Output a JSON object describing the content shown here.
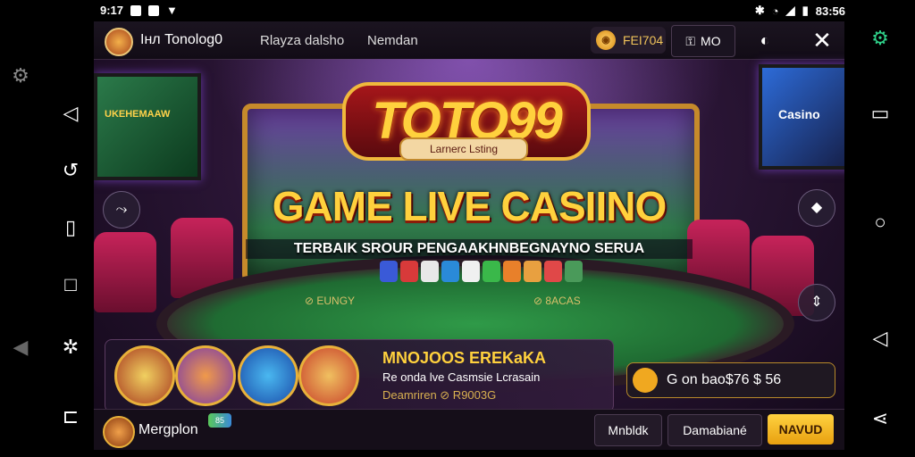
{
  "statusbar": {
    "left_text": "9:17",
    "right_text": "83:56"
  },
  "topbar": {
    "brand": "Iнл Tonolog0",
    "nav": [
      "Rlayza dalsho",
      "Nemdan"
    ],
    "coins": "FEI704",
    "mo_button": "MO"
  },
  "hero": {
    "logo_text": "TOTO99",
    "logo_subtitle": "Larnerc Lsting",
    "headline": "GAME LIVE CASIINO",
    "tagline": "TERBAIK SROUR PENGAAKHNBEGNAYNO SERUA",
    "left_tv_text": "UKEHEMAAW",
    "right_tv_text": "Casino",
    "table_left_text": "⊘ EUNGY",
    "table_right_text": "⊘ 8ACAS"
  },
  "panel": {
    "title": "MNOJOOS EREKaKA",
    "line1": "Re onda lve Casmsie Lcrasain",
    "line2": "Deamriren ⊘ R9003G"
  },
  "bonus": {
    "text": "G on bao$76 $ 56"
  },
  "bottombar": {
    "username": "Mergplon",
    "badge": "85",
    "buttons": [
      "Mnbldk",
      "Damabiané",
      "NAVUD"
    ]
  }
}
